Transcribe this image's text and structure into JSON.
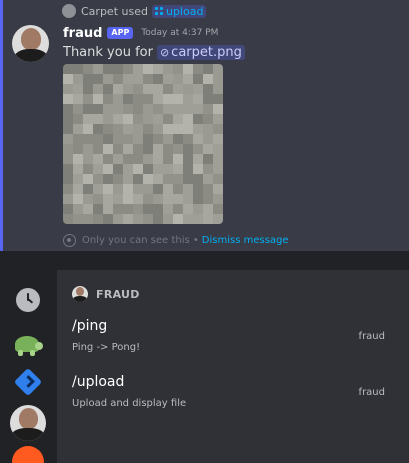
{
  "reply": {
    "user": "Carpet",
    "verb": "used",
    "command": "upload"
  },
  "message": {
    "author": "fraud",
    "badge": "APP",
    "timestamp": "Today at 4:37 PM",
    "text": "Thank you for",
    "file_name": "carpet.png"
  },
  "notice": {
    "text": "Only you can see this •",
    "dismiss": "Dismiss message"
  },
  "picker": {
    "bot_name": "FRAUD",
    "commands": [
      {
        "name": "/ping",
        "description": "Ping -> Pong!",
        "source": "fraud"
      },
      {
        "name": "/upload",
        "description": "Upload and display file",
        "source": "fraud"
      }
    ]
  },
  "rail_icons": [
    "clock-icon",
    "turtle-icon",
    "blue-app-icon",
    "bot-avatar-icon",
    "orange-app-icon"
  ],
  "colors": {
    "accent": "#5865f2",
    "link": "#00aff4",
    "chat_bg": "#36393f",
    "picker_bg": "#2f3136",
    "rail_bg": "#202225"
  }
}
